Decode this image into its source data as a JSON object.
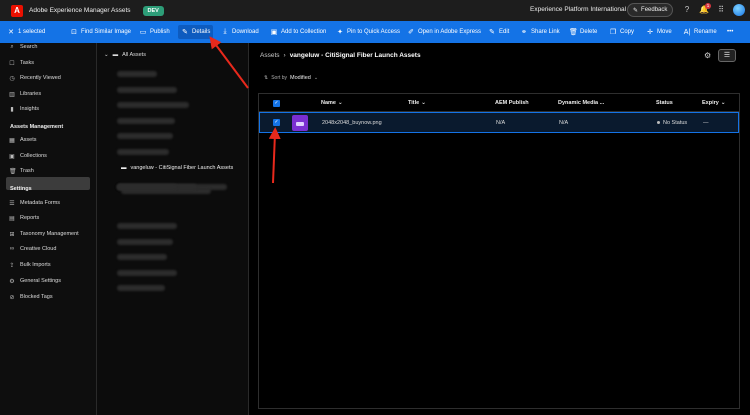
{
  "header": {
    "app_title": "Adobe Experience Manager Assets",
    "env": "DEV",
    "org": "Experience Platform International",
    "feedback": "Feedback",
    "notifications": "1"
  },
  "actions": {
    "selected": "1 selected",
    "find_similar": "Find Similar Image",
    "publish": "Publish",
    "details": "Details",
    "download": "Download",
    "add_collection": "Add to Collection",
    "pin": "Pin to Quick Access",
    "open_express": "Open in Adobe Express",
    "edit": "Edit",
    "share": "Share Link",
    "delete": "Delete",
    "copy": "Copy",
    "move": "Move",
    "rename": "Rename",
    "more": "•••"
  },
  "sidebar": {
    "search": "Search",
    "tasks": "Tasks",
    "recent": "Recently Viewed",
    "libraries": "Libraries",
    "insights": "Insights",
    "section_assets": "Assets Management",
    "assets": "Assets",
    "collections": "Collections",
    "trash": "Trash",
    "section_settings": "Settings",
    "metadata": "Metadata Forms",
    "reports": "Reports",
    "taxonomy": "Taxonomy Management",
    "creative": "Creative Cloud",
    "bulk": "Bulk Imports",
    "general": "General Settings",
    "blocked": "Blocked Tags"
  },
  "tree": {
    "root": "All Assets",
    "selected_folder": "vangeluw - CitiSignal Fiber Launch Assets"
  },
  "main": {
    "crumb_root": "Assets",
    "crumb_sep": "›",
    "crumb_current": "vangeluw - CitiSignal Fiber Launch Assets",
    "sort_label": "Sort by",
    "sort_value": "Modified"
  },
  "table": {
    "headers": {
      "name": "Name",
      "title": "Title",
      "aem_publish": "AEM Publish",
      "dynamic_media": "Dynamic Media ...",
      "status": "Status",
      "expiry": "Expiry"
    },
    "rows": [
      {
        "name": "2048x2048_buynow.png",
        "aem_publish": "N/A",
        "dynamic_media": "N/A",
        "status": "No Status",
        "expiry": "—"
      }
    ]
  },
  "colors": {
    "accent": "#1473e6",
    "annotation": "#e8291c",
    "env_badge": "#2d9d78"
  }
}
